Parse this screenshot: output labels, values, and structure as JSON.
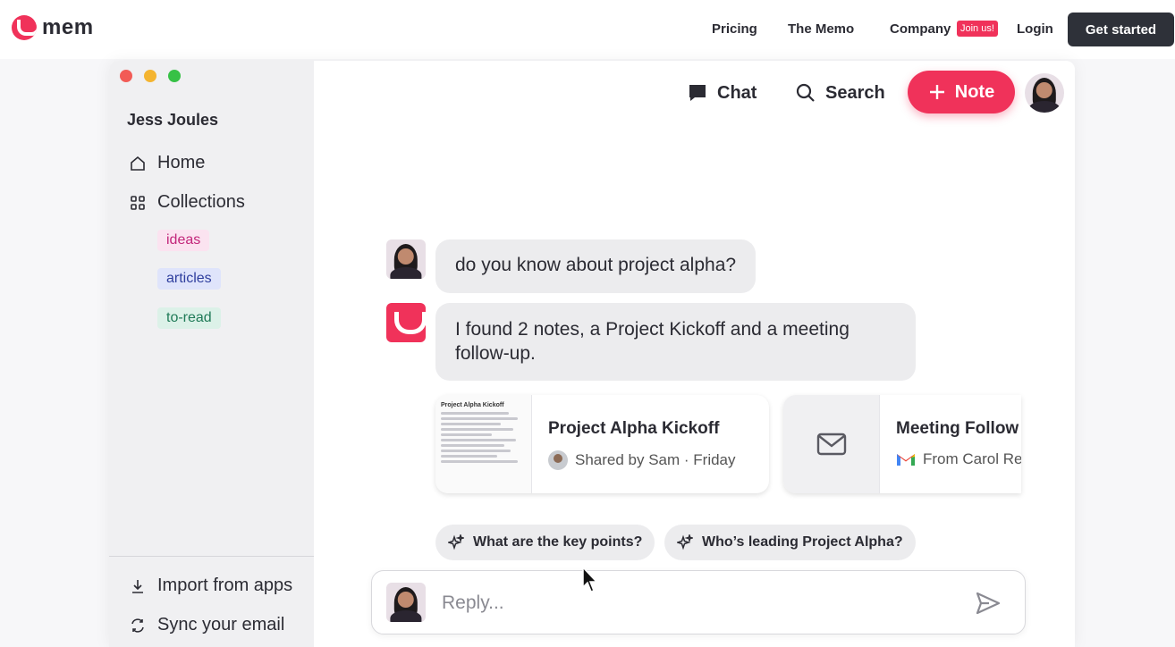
{
  "site_nav": {
    "logo_text": "mem",
    "links": [
      "Pricing",
      "The Memo",
      "Company"
    ],
    "join_badge": "Join us!",
    "login": "Login",
    "cta": "Get started"
  },
  "sidebar": {
    "user_name": "Jess Joules",
    "items": [
      {
        "label": "Home",
        "icon": "home-icon"
      },
      {
        "label": "Collections",
        "icon": "grid-icon"
      }
    ],
    "tags": [
      {
        "label": "ideas",
        "bg": "#fbe3f0",
        "fg": "#c2267a"
      },
      {
        "label": "articles",
        "bg": "#dfe4fb",
        "fg": "#2f3f9e"
      },
      {
        "label": "to-read",
        "bg": "#dcf1e8",
        "fg": "#1f7a57"
      }
    ],
    "bottom_items": [
      {
        "label": "Import from apps",
        "icon": "download-icon"
      },
      {
        "label": "Sync your email",
        "icon": "sync-icon"
      }
    ]
  },
  "header": {
    "chat": "Chat",
    "search": "Search",
    "note": "Note"
  },
  "chat": {
    "user_message": "do you know about project alpha?",
    "bot_message": "I found 2 notes, a Project Kickoff and a meeting follow-up.",
    "cards": [
      {
        "title": "Project Alpha Kickoff",
        "subtitle": "Shared by Sam · Friday",
        "thumb_title": "Project Alpha Kickoff"
      },
      {
        "title": "Meeting Follow",
        "subtitle": "From Carol Ree"
      }
    ],
    "suggestions": [
      "What are the key points?",
      "Who’s leading Project Alpha?"
    ],
    "reply_placeholder": "Reply..."
  },
  "colors": {
    "accent": "#f0325a",
    "dark": "#2e3139"
  }
}
